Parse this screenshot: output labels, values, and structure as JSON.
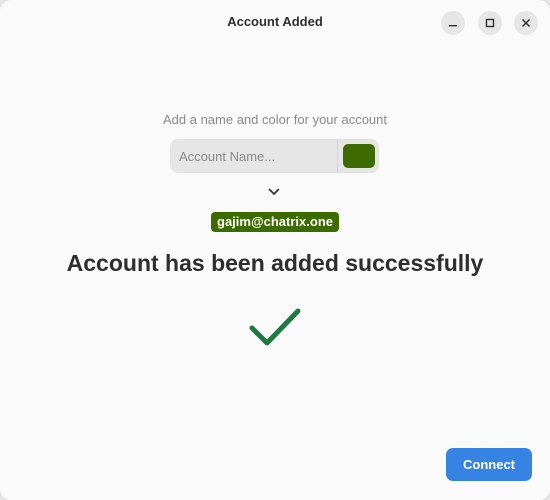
{
  "window": {
    "title": "Account Added"
  },
  "titlebar": {
    "minimize_icon": "minimize-icon",
    "maximize_icon": "maximize-icon",
    "close_icon": "close-icon"
  },
  "form": {
    "hint": "Add a name and color for your account",
    "name_placeholder": "Account Name...",
    "name_value": "",
    "account_color": "#3e6b00"
  },
  "account": {
    "jid": "gajim@chatrix.one"
  },
  "status": {
    "headline": "Account has been added successfully",
    "success_icon": "checkmark-icon",
    "success_color": "#1e7a40"
  },
  "actions": {
    "connect_label": "Connect",
    "accent_color": "#3584e4"
  }
}
